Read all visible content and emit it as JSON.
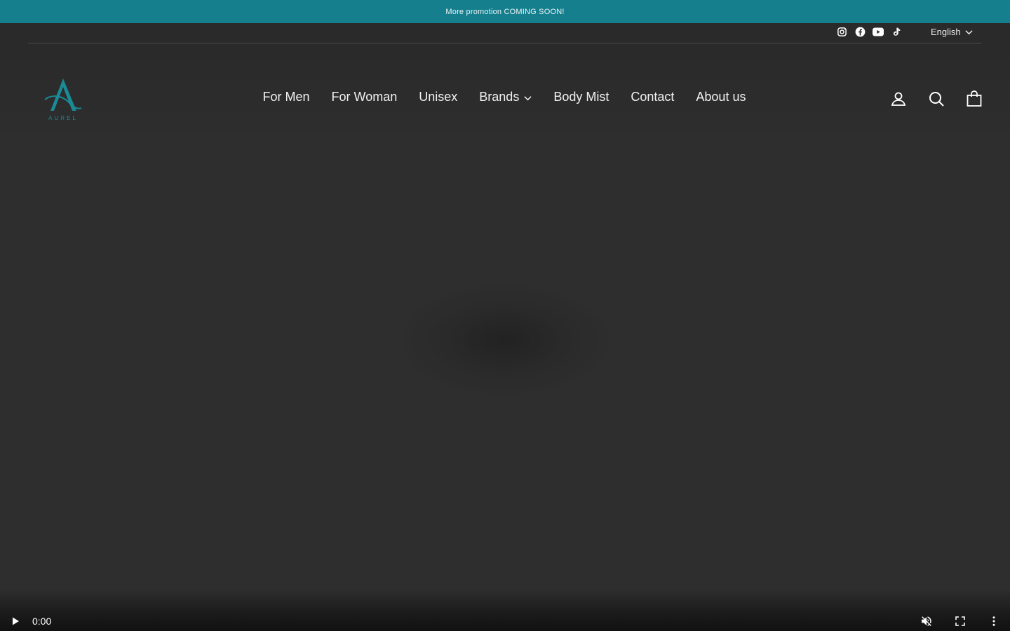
{
  "announcement": {
    "text": "More promotion COMING SOON!"
  },
  "topbar": {
    "social": [
      {
        "icon": "instagram-icon"
      },
      {
        "icon": "facebook-icon"
      },
      {
        "icon": "youtube-icon"
      },
      {
        "icon": "tiktok-icon"
      }
    ],
    "language": "English"
  },
  "header": {
    "logo_text": "AUREL",
    "nav": [
      {
        "label": "For Men"
      },
      {
        "label": "For Woman"
      },
      {
        "label": "Unisex"
      },
      {
        "label": "Brands",
        "has_dropdown": true
      },
      {
        "label": "Body Mist"
      },
      {
        "label": "Contact"
      },
      {
        "label": "About us"
      }
    ],
    "icons": [
      "account-icon",
      "search-icon",
      "cart-icon"
    ]
  },
  "video": {
    "time": "0:00"
  },
  "colors": {
    "accent": "#167f8e",
    "background": "#2e2e2e",
    "logo": "#1a8a96"
  }
}
